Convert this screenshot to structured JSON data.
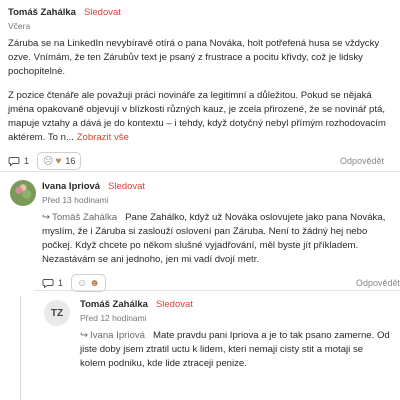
{
  "comments": {
    "top": {
      "author": "Tomáš Zahálka",
      "follow_label": "Sledovat",
      "time": "Včera",
      "paragraph1": "Záruba se na LinkedIn nevybíravě otírá o pana Nováka, holt potřefená husa se vždycky ozve. Vnímám, že ten Zárubův text je psaný z frustrace a pocitu křivdy, což je lidsky pochopitelné.",
      "paragraph2": "Z pozice čtenáře ale považuji práci novináře za legitimní a důležitou. Pokud se nějaká jména opakovaně objevují v blízkosti různých kauz, je zcela přirozené, že se novinář ptá, mapuje vztahy a dává je do kontextu – i tehdy, když dotyčný nebyl přímým rozhodovacím aktérem. To n...",
      "show_more": "Zobrazit vše",
      "comment_count": "1",
      "reaction_count": "16",
      "reply_label": "Odpovědět"
    },
    "reply1": {
      "author": "Ivana Ipriová",
      "follow_label": "Sledovat",
      "time": "Před 13 hodinami",
      "reply_to": "Tomáš Zahálka",
      "text": "Pane Zahálko, když už Nováka oslovujete jako pana Nováka, myslím, že i Záruba si zaslouží oslovení pan Záruba. Není to žádný hej nebo počkej. Když chcete po někom slušné vyjadřování, měl byste jít příkladem. Nezastávám se ani jednoho, jen mi vadí dvojí metr.",
      "comment_count": "1",
      "reply_label": "Odpovědět"
    },
    "reply2": {
      "initials": "TZ",
      "author": "Tomáš Zahálka",
      "follow_label": "Sledovat",
      "time": "Před 12 hodinami",
      "reply_to": "Ivana Ipriová",
      "text": "Mate pravdu pani Ipriova a je to tak psano zamerne. Od jiste doby jsem ztratil uctu k lidem, kteri nemaji cisty stit a motaji se kolem podniku, kde lide ztraceji penize."
    }
  }
}
